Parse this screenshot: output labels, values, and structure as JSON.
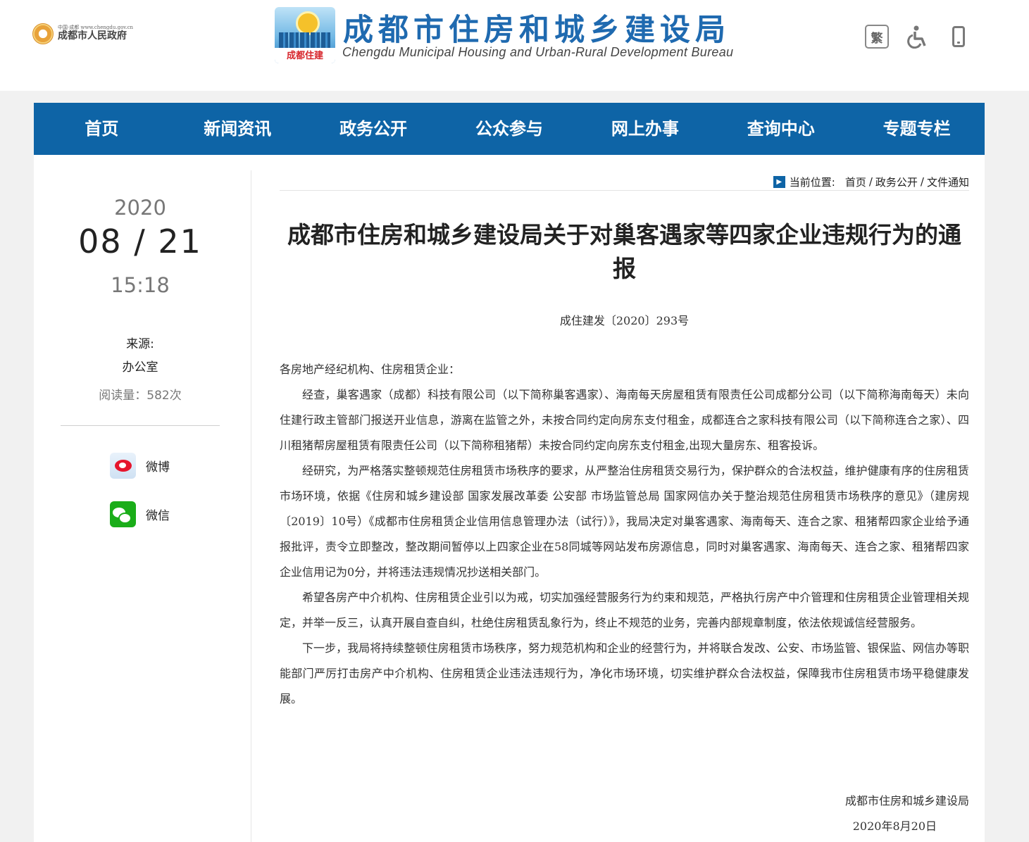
{
  "header": {
    "gov_small": "中国·成都 www.chengdu.gov.cn",
    "gov_name": "成都市人民政府",
    "logo_plate": "成都住建",
    "title": "成都市住房和城乡建设局",
    "title_en": "Chengdu Municipal Housing and Urban-Rural Development Bureau",
    "tools": {
      "traditional": "繁",
      "accessibility_icon": "wheelchair-icon",
      "mobile_icon": "mobile-phone-icon"
    }
  },
  "nav": [
    "首页",
    "新闻资讯",
    "政务公开",
    "公众参与",
    "网上办事",
    "查询中心",
    "专题专栏"
  ],
  "sidebar": {
    "year": "2020",
    "date": "08 / 21",
    "time": "15:18",
    "source_label": "来源:",
    "source": "办公室",
    "reads": "阅读量：582次",
    "share": [
      {
        "label": "微博",
        "icon": "weibo-icon"
      },
      {
        "label": "微信",
        "icon": "wechat-icon"
      }
    ]
  },
  "breadcrumb": {
    "label": "当前位置:",
    "items": [
      "首页",
      "政务公开",
      "文件通知"
    ],
    "separator": "/"
  },
  "article": {
    "title": "成都市住房和城乡建设局关于对巢客遇家等四家企业违规行为的通报",
    "doc_no": "成住建发〔2020〕293号",
    "salutation": "各房地产经纪机构、住房租赁企业：",
    "paragraphs": [
      "经查，巢客遇家（成都）科技有限公司（以下简称巢客遇家）、海南每天房屋租赁有限责任公司成都分公司（以下简称海南每天）未向住建行政主管部门报送开业信息，游离在监管之外，未按合同约定向房东支付租金，成都连合之家科技有限公司（以下简称连合之家）、四川租猪帮房屋租赁有限责任公司（以下简称租猪帮）未按合同约定向房东支付租金,出现大量房东、租客投诉。",
      "经研究，为严格落实整顿规范住房租赁市场秩序的要求，从严整治住房租赁交易行为，保护群众的合法权益，维护健康有序的住房租赁市场环境，依据《住房和城乡建设部 国家发展改革委 公安部 市场监管总局 国家网信办关于整治规范住房租赁市场秩序的意见》（建房规〔2019〕10号）《成都市住房租赁企业信用信息管理办法（试行）》，我局决定对巢客遇家、海南每天、连合之家、租猪帮四家企业给予通报批评，责令立即整改，整改期间暂停以上四家企业在58同城等网站发布房源信息，同时对巢客遇家、海南每天、连合之家、租猪帮四家企业信用记为0分，并将违法违规情况抄送相关部门。",
      "希望各房产中介机构、住房租赁企业引以为戒，切实加强经营服务行为约束和规范，严格执行房产中介管理和住房租赁企业管理相关规定，并举一反三，认真开展自查自纠，杜绝住房租赁乱象行为，终止不规范的业务，完善内部规章制度，依法依规诚信经营服务。",
      "下一步，我局将持续整顿住房租赁市场秩序，努力规范机构和企业的经营行为，并将联合发改、公安、市场监管、银保监、网信办等职能部门严厉打击房产中介机构、住房租赁企业违法违规行为，净化市场环境，切实维护群众合法权益，保障我市住房租赁市场平稳健康发展。"
    ],
    "signature": "成都市住房和城乡建设局",
    "sign_date": "2020年8月20日"
  },
  "colors": {
    "nav_bg": "#0e64a6",
    "title_blue": "#1f6ab0",
    "page_bg": "#f1f1f1"
  }
}
